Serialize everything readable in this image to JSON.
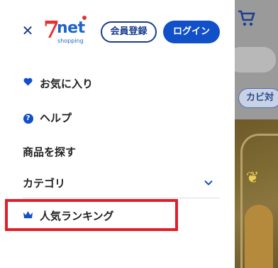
{
  "background": {
    "chip_label": "カビ対"
  },
  "header": {
    "logo": {
      "main": "7net",
      "seven": "7",
      "net": "net",
      "sub": "shopping"
    },
    "register_label": "会員登録",
    "login_label": "ログイン"
  },
  "menu": {
    "favorites": "お気に入り",
    "help": "ヘルプ",
    "search_products": "商品を探す",
    "category": "カテゴリ",
    "ranking": "人気ランキング"
  },
  "colors": {
    "brand_blue": "#1150c8",
    "navy": "#1a3d8f",
    "logo_red": "#e8312f",
    "highlight_red": "#e01e2b"
  }
}
